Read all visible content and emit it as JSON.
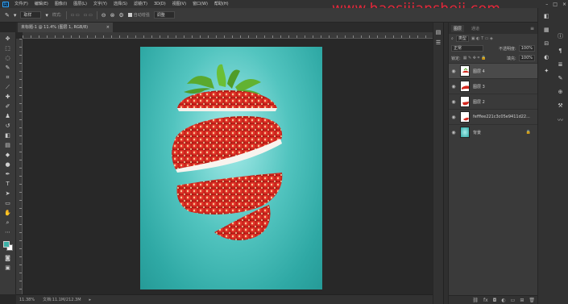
{
  "menu": [
    "文件(F)",
    "编辑(E)",
    "图像(I)",
    "图层(L)",
    "文字(Y)",
    "选择(S)",
    "滤镜(T)",
    "3D(D)",
    "视图(V)",
    "窗口(W)",
    "帮助(H)"
  ],
  "watermark": "www.haosijiansheji.com",
  "options": {
    "sample_label": "取样",
    "size_label": "样式:",
    "auto_select": "自动增强",
    "edge": "调整"
  },
  "doc_tab": {
    "title": "未标题-1 @ 11.4% (图层 1, RGB/8)",
    "close": "×"
  },
  "status": {
    "zoom": "11.38%",
    "doc": "文档:11.1M/212.3M"
  },
  "layers_panel": {
    "tabs": [
      "图层",
      "通道"
    ],
    "kind_label": "类型",
    "blend_mode": "正常",
    "opacity_label": "不透明度:",
    "opacity_value": "100%",
    "lock_label": "锁定:",
    "fill_label": "填充:",
    "fill_value": "100%",
    "layers": [
      {
        "name": "图层 4",
        "selected": true
      },
      {
        "name": "图层 3",
        "selected": false
      },
      {
        "name": "图层 2",
        "selected": false
      },
      {
        "name": "fefffee221c3c05e9411d22...",
        "selected": false
      },
      {
        "name": "背景",
        "selected": false,
        "locked": true
      }
    ]
  },
  "colors": {
    "foreground": "#3bb0a6",
    "background": "#ffffff",
    "canvas_teal": "#52c4bf",
    "watermark": "#e8273a"
  }
}
